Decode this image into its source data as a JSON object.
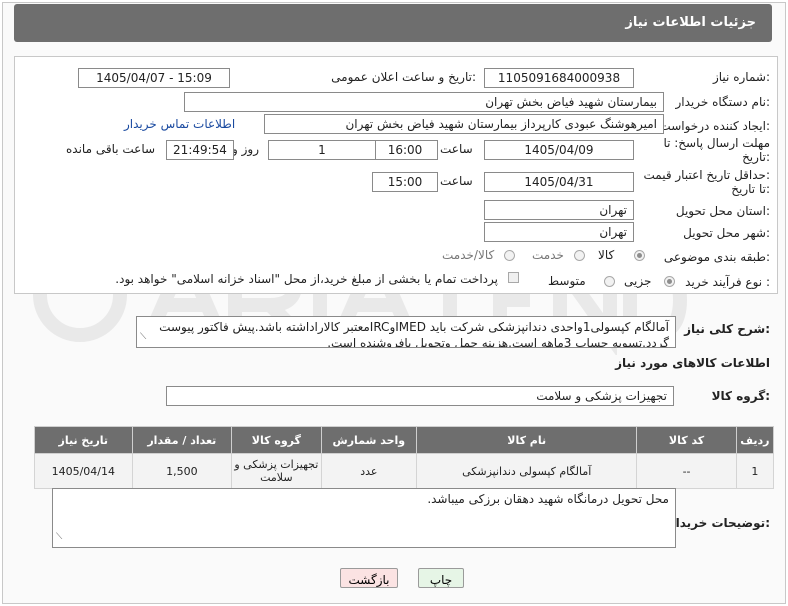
{
  "header": {
    "title": "جزئیات اطلاعات نیاز"
  },
  "form": {
    "need_number_label": "شماره نیاز:",
    "need_number": "1105091684000938",
    "announce_label": "تاریخ و ساعت اعلان عمومی:",
    "announce_value": "1405/04/07 - 15:09",
    "buyer_org_label": "نام دستگاه خریدار:",
    "buyer_org": "بیمارستان شهید فیاض بخش تهران",
    "creator_label": "ایجاد کننده درخواست:",
    "creator": "امیرهوشنگ عبودی کارپرداز بیمارستان شهید فیاض بخش تهران",
    "contact_link": "اطلاعات تماس خریدار",
    "reply_deadline_label_1": "مهلت ارسال پاسخ: تا",
    "reply_deadline_label_2": "تاریخ:",
    "reply_date": "1405/04/09",
    "time_label": "ساعت",
    "reply_time": "16:00",
    "days_value": "1",
    "days_label": "روز و",
    "remaining_time": "21:49:54",
    "remaining_label": "ساعت باقی مانده",
    "price_validity_label_1": "حداقل تاریخ اعتبار قیمت:",
    "price_validity_label_2": "تا تاریخ:",
    "price_date": "1405/04/31",
    "price_time": "15:00",
    "province_label": "استان محل تحویل:",
    "province": "تهران",
    "city_label": "شهر محل تحویل:",
    "city": "تهران",
    "category_label": "طبقه بندی موضوعی:",
    "category_options": [
      "کالا",
      "خدمت",
      "کالا/خدمت"
    ],
    "purchase_type_label": "نوع فرآیند خرید :",
    "purchase_options": [
      "جزیی",
      "متوسط"
    ],
    "payment_note": "پرداخت تمام یا بخشی از مبلغ خرید،از محل \"اسناد خزانه اسلامی\" خواهد بود."
  },
  "description": {
    "label": "شرح کلی نیاز:",
    "text": "آمالگام کپسولی1واحدی دندانپزشکی شرکت باید IMEDوIRCمعتبر کالاراداشته باشد.پیش فاکتور پیوست گردد.تسویه حساب 3ماهه است.هزینه حمل وتحویل بافروشنده است."
  },
  "items_section": {
    "title": "اطلاعات کالاهای مورد نیاز",
    "group_label": "گروه کالا:",
    "group_value": "تجهیزات پزشکی و سلامت"
  },
  "items_table": {
    "columns": [
      "ردیف",
      "کد کالا",
      "نام کالا",
      "واحد شمارش",
      "گروه کالا",
      "تعداد / مقدار",
      "تاریخ نیاز"
    ],
    "rows": [
      [
        "1",
        "--",
        "آمالگام کپسولی دندانپزشکی",
        "عدد",
        "تجهیزات پزشکی و سلامت",
        "1,500",
        "1405/04/14"
      ]
    ]
  },
  "buyer_notes": {
    "label": "توضیحات خریدار:",
    "text": "محل تحویل درمانگاه شهید دهقان برزکی میباشد."
  },
  "buttons": {
    "print": "چاپ",
    "back": "بازگشت"
  },
  "colors": {
    "header_bg": "#6e6e6e",
    "link": "#1a4aa0",
    "print_bg": "#e6f5e6",
    "back_bg": "#fbe3e3"
  }
}
